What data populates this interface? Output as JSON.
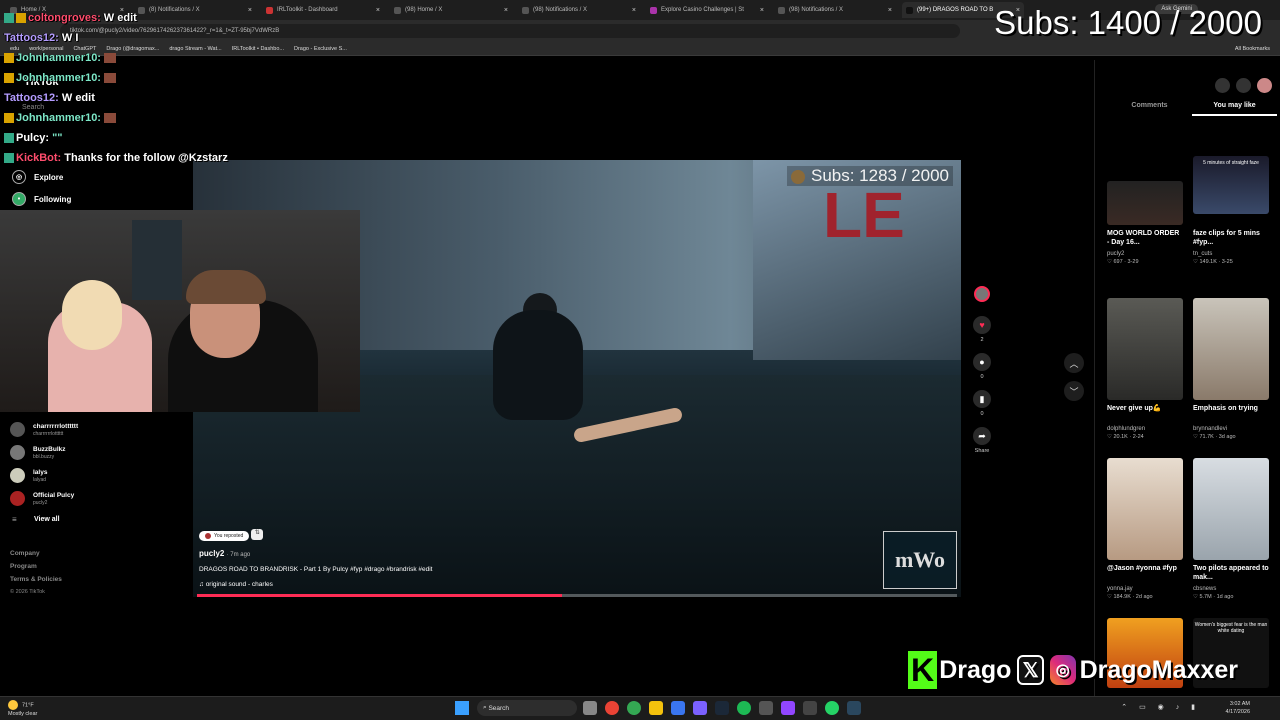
{
  "browser": {
    "tabs": [
      {
        "label": "Home / X",
        "active": false
      },
      {
        "label": "(8) Notifications / X",
        "active": false
      },
      {
        "label": "IRLToolkit - Dashboard",
        "active": false
      },
      {
        "label": "(98) Home / X",
        "active": false
      },
      {
        "label": "(98) Notifications / X",
        "active": false
      },
      {
        "label": "Explore Casino Challenges | St",
        "active": false
      },
      {
        "label": "(98) Notifications / X",
        "active": false
      },
      {
        "label": "(99+) DRAGOS ROAD TO B",
        "active": true
      }
    ],
    "url": "tiktok.com/@pucly2/video/7629617426237361422?_r=1&_t=ZT-95bj7VdWRzB",
    "ask_gemini": "Ask Gemini",
    "bookmarks": [
      "edu",
      "work/personal",
      "ChatGPT",
      "Drago (@dragomax...",
      "drago Stream - Wat...",
      "IRLToolkit • Dashbo...",
      "Drago - Exclusive S..."
    ],
    "all_bookmarks": "All Bookmarks"
  },
  "tiktok": {
    "logo": "TikTok",
    "search_placeholder": "Search",
    "nav": [
      {
        "label": "Explore",
        "icon": "compass-icon"
      },
      {
        "label": "Following",
        "icon": "following-icon"
      }
    ],
    "following": [
      {
        "name": "charrrrrrlotttttt",
        "handle": "charrrrrrlotttttt"
      },
      {
        "name": "BuzzBulkz",
        "handle": "bbl.buzzy"
      },
      {
        "name": "lalys",
        "handle": "lalyad"
      },
      {
        "name": "Official Pulcy",
        "handle": "pucly2"
      }
    ],
    "view_all": "View all",
    "footer": [
      "Company",
      "Program",
      "Terms & Policies"
    ],
    "copyright": "© 2026 TikTok",
    "video": {
      "overlay_subs": "Subs: 1283 / 2000",
      "watermark": "mWo",
      "repost_label": "You reposted",
      "author": "pucly2",
      "time": "· 7m ago",
      "caption": "DRAGOS ROAD TO BRANDRISK - Part 1 By Pulcy #fyp #drago #brandrisk #edit",
      "sound": "original sound - charles",
      "progress": 0.48
    },
    "actions": [
      {
        "icon": "heart-icon",
        "count": "2"
      },
      {
        "icon": "comment-icon",
        "count": "0"
      },
      {
        "icon": "bookmark-icon",
        "count": "0"
      },
      {
        "icon": "share-icon",
        "count": "Share"
      }
    ],
    "right_tabs": [
      {
        "label": "Comments",
        "active": false
      },
      {
        "label": "You may like",
        "active": true
      }
    ],
    "suggested": [
      {
        "title": "MOG WORLD ORDER - Day 16...",
        "author": "pucly2",
        "likes": "697",
        "date": "3-29",
        "thumb_text": ""
      },
      {
        "title": "faze clips for 5 mins #fyp...",
        "author": "tn_cuts",
        "likes": "149.1K",
        "date": "3-25",
        "thumb_text": "5 minutes of straight faze"
      },
      {
        "title": "Never give up💪",
        "author": "dolphlundgren",
        "likes": "20.1K",
        "date": "2-24",
        "thumb_text": ""
      },
      {
        "title": "Emphasis on trying",
        "author": "brynnandlevi",
        "likes": "71.7K",
        "date": "3d ago",
        "thumb_text": ""
      },
      {
        "title": "@Jason #yonna #fyp",
        "author": "yonna.jay",
        "likes": "184.9K",
        "date": "2d ago",
        "thumb_text": ""
      },
      {
        "title": "Two pilots appeared to mak...",
        "author": "cbsnews",
        "likes": "5.7M",
        "date": "1d ago",
        "thumb_text": ""
      },
      {
        "title": "",
        "author": "",
        "likes": "",
        "date": "",
        "thumb_text": ""
      },
      {
        "title": "",
        "author": "",
        "likes": "",
        "date": "",
        "thumb_text": "Women's biggest fear is the man white dating"
      }
    ]
  },
  "stream": {
    "subs_goal": "Subs: 1400 / 2000",
    "chat": [
      {
        "user": "coltongroves:",
        "text": "W edit",
        "color": "red"
      },
      {
        "user": "Tattoos12:",
        "text": "W I",
        "color": "purple"
      },
      {
        "user": "Johnhammer10:",
        "text": "",
        "color": "green"
      },
      {
        "user": "Johnhammer10:",
        "text": "",
        "color": "green"
      },
      {
        "user": "Tattoos12:",
        "text": "W edit",
        "color": "purple"
      },
      {
        "user": "Johnhammer10:",
        "text": "",
        "color": "green"
      },
      {
        "user": "Pulcy:",
        "text": "\"\"",
        "color": "white"
      },
      {
        "user": "KickBot:",
        "text": "Thanks for the follow @Kzstarz",
        "color": "red"
      }
    ],
    "socials_kick": "Drago",
    "socials_handle": "DragoMaxxer"
  },
  "taskbar": {
    "weather_temp": "71°F",
    "weather_desc": "Mostly clear",
    "search": "Search",
    "time": "3:02 AM",
    "date": "4/17/2026"
  },
  "colors": {
    "accent": "#fe2c55",
    "kick_green": "#53fc18"
  }
}
